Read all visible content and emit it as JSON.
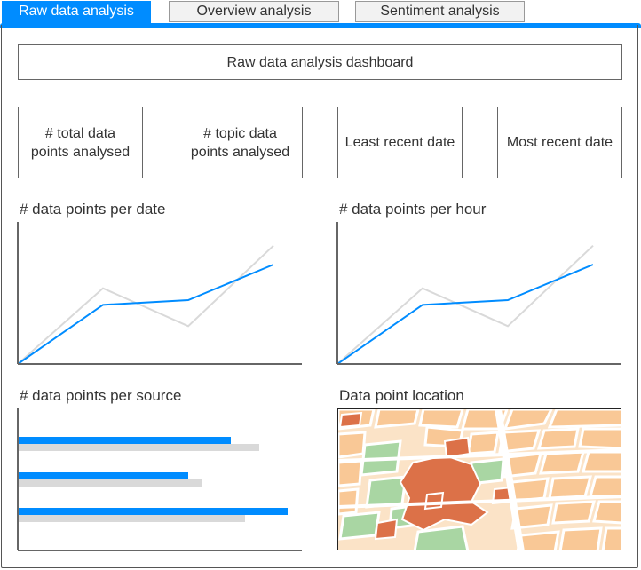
{
  "tabs": [
    {
      "label": "Raw data analysis",
      "active": true
    },
    {
      "label": "Overview analysis",
      "active": false
    },
    {
      "label": "Sentiment analysis",
      "active": false
    }
  ],
  "dashboard_title": "Raw data analysis dashboard",
  "kpis": [
    {
      "label": "# total data points analysed"
    },
    {
      "label": "# topic data points analysed"
    },
    {
      "label": "Least recent date"
    },
    {
      "label": "Most recent date"
    }
  ],
  "colors": {
    "accent": "#008cff",
    "ghost": "#d9d9d9",
    "axis": "#666666",
    "map_water": "#ffffff",
    "map_block": "#f9c896",
    "map_park": "#a9d6a3",
    "map_main": "#dc7148"
  },
  "chart_data": [
    {
      "type": "line",
      "title": "# data points per date",
      "x": [
        0,
        1,
        2,
        3
      ],
      "series": [
        {
          "values": [
            0,
            12.5,
            13.5,
            21
          ]
        },
        {
          "values": [
            0,
            16,
            8,
            25
          ]
        }
      ],
      "ylim": [
        0,
        30
      ]
    },
    {
      "type": "line",
      "title": "# data points per hour",
      "x": [
        0,
        1,
        2,
        3
      ],
      "series": [
        {
          "values": [
            0,
            12.5,
            13.5,
            21
          ]
        },
        {
          "values": [
            0,
            16,
            8,
            25
          ]
        }
      ],
      "ylim": [
        0,
        30
      ]
    },
    {
      "type": "bar",
      "orientation": "horizontal",
      "title": "# data points per source",
      "categories": [
        "",
        "",
        ""
      ],
      "series": [
        {
          "values": [
            240,
            192,
            304
          ]
        },
        {
          "values": [
            272,
            208,
            256
          ]
        }
      ],
      "xlim": [
        0,
        320
      ]
    }
  ],
  "map_title": "Data point location",
  "map_icon": "city-map-image"
}
